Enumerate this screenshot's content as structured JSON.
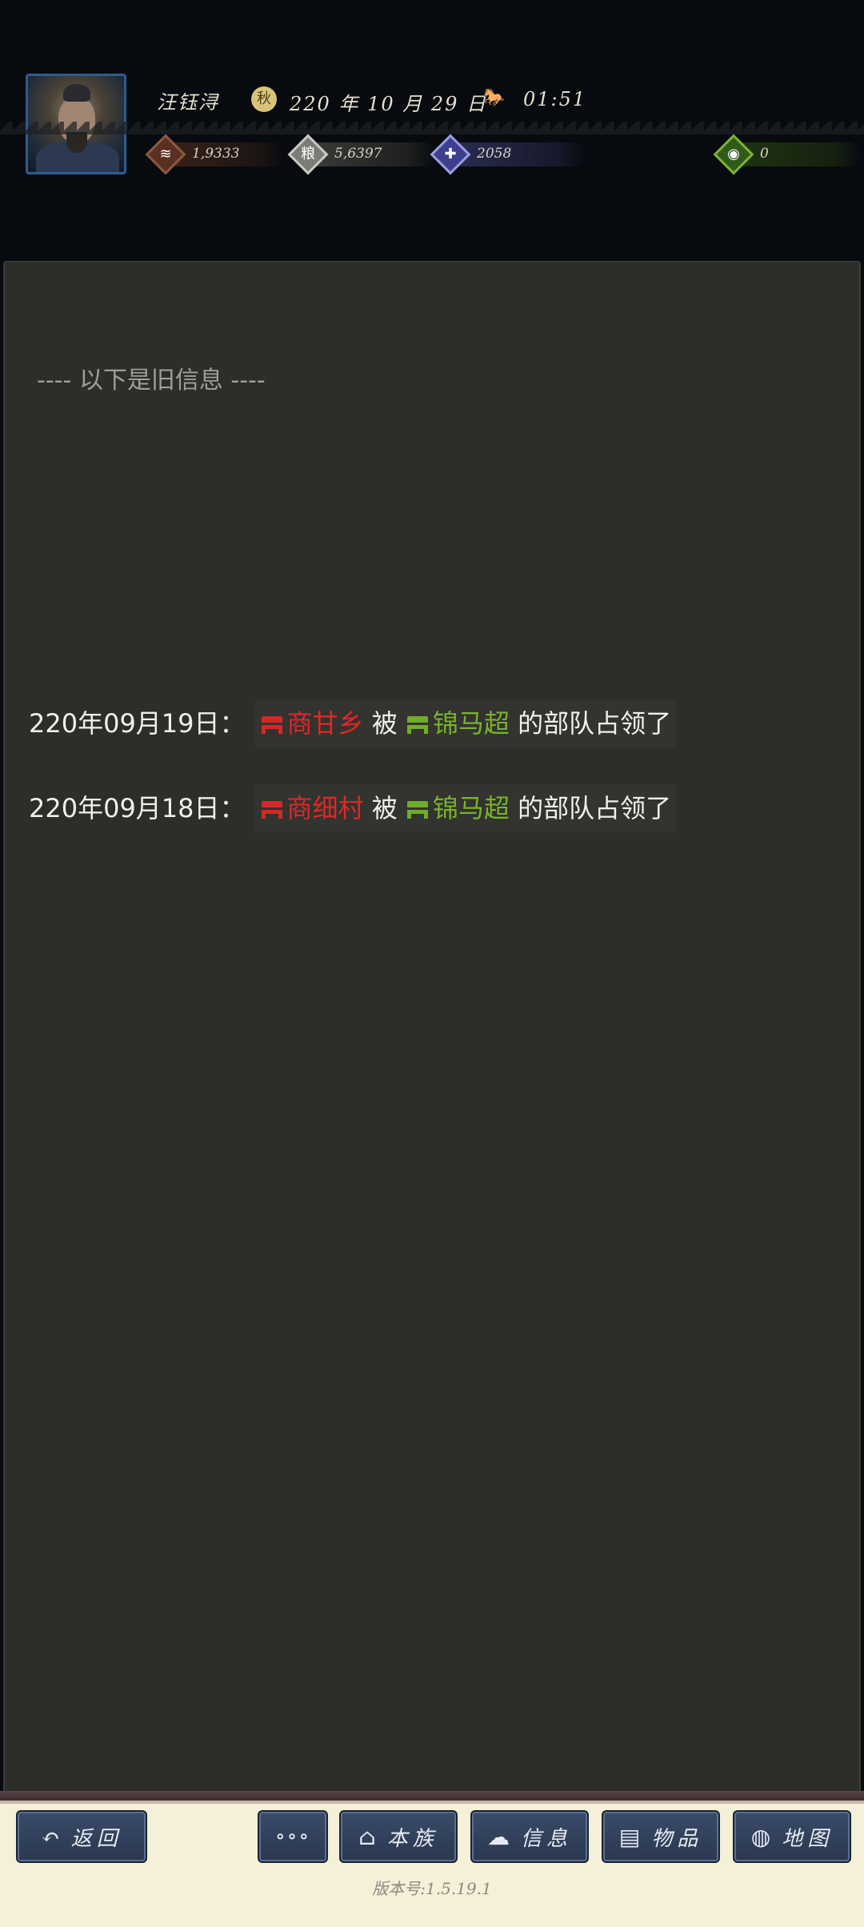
{
  "header": {
    "player_name": "汪钰浔",
    "date": "220 年 10 月 29 日",
    "clock": "01:51",
    "resources": {
      "coin": "1,9333",
      "grain": "5,6397",
      "troops": "2058",
      "bag": "0"
    },
    "icons": [
      "avatar",
      "season-icon",
      "horse-icon",
      "coin-icon",
      "grain-icon",
      "troops-icon",
      "bag-icon"
    ]
  },
  "messages": {
    "old_info_divider": "---- 以下是旧信息 ----",
    "events": [
      {
        "date": "220年09月19日：",
        "place": "商甘乡",
        "verb": "被",
        "lord": "锦马超",
        "suffix": "的部队占领了"
      },
      {
        "date": "220年09月18日：",
        "place": "商细村",
        "verb": "被",
        "lord": "锦马超",
        "suffix": "的部队占领了"
      }
    ]
  },
  "nav": {
    "back": "返回",
    "more": "∘∘∘",
    "clan": "本族",
    "info": "信息",
    "items": "物品",
    "map": "地图"
  },
  "version": "版本号:1.5.19.1",
  "colors": {
    "panel_bg": "#2d2d29",
    "enemy_red": "#e02727",
    "ally_green": "#79b22e",
    "button_bg": "#2a3850"
  }
}
